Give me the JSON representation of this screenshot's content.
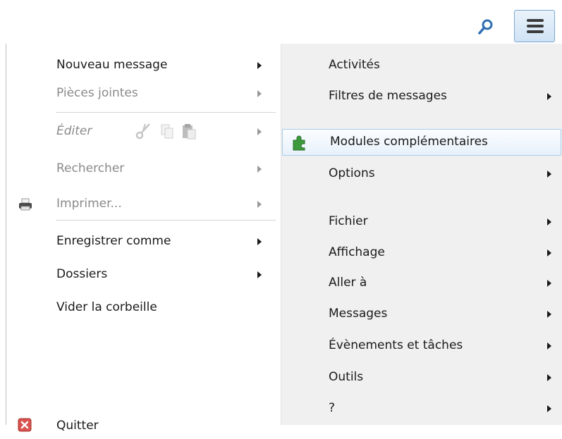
{
  "toolbar": {
    "search_icon": "search-icon",
    "menu_icon": "hamburger-menu-icon"
  },
  "left_menu": {
    "new_message": "Nouveau message",
    "attachments": "Pièces jointes",
    "edit": "Éditer",
    "search": "Rechercher",
    "print": "Imprimer...",
    "save_as": "Enregistrer comme",
    "folders": "Dossiers",
    "empty_trash": "Vider la corbeille",
    "quit": "Quitter"
  },
  "right_menu": {
    "activities": "Activités",
    "message_filters": "Filtres de messages",
    "addons": "Modules complémentaires",
    "options": "Options",
    "file": "Fichier",
    "view": "Affichage",
    "go_to": "Aller à",
    "messages": "Messages",
    "events_tasks": "Évènements et tâches",
    "tools": "Outils",
    "help": "?"
  },
  "colors": {
    "accent": "#3a86c8",
    "quit_red": "#d9534f",
    "puzzle_green": "#3c9a3c"
  }
}
